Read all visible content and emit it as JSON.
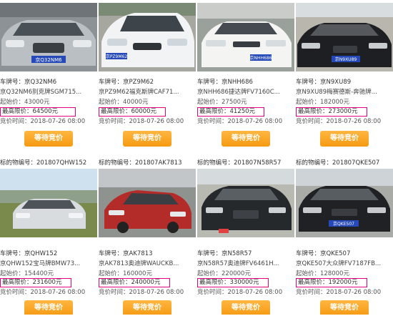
{
  "labels": {
    "lot_no": "标的物编号：",
    "plate": "车牌号：",
    "start_price": "起始价：",
    "max_price": "最高限价：",
    "bid_time": "竞价时间：",
    "bid_button": "等待竞价"
  },
  "cards": [
    {
      "lot_no": "",
      "plate": "京Q32NM6",
      "model": "京Q32NM6别克牌SGM715...",
      "start_price": "43000元",
      "max_price": "64500元",
      "bid_time": "2018-07-26 08:00"
    },
    {
      "lot_no": "",
      "plate": "京PZ9M62",
      "model": "京PZ9M62福克斯牌CAF71...",
      "start_price": "40000元",
      "max_price": "60000元",
      "bid_time": "2018-07-26 08:00"
    },
    {
      "lot_no": "",
      "plate": "京NHH686",
      "model": "京NHH686捷达牌FV7160C...",
      "start_price": "27500元",
      "max_price": "41250元",
      "bid_time": "2018-07-26 08:00"
    },
    {
      "lot_no": "",
      "plate": "京N9XU89",
      "model": "京N9XU89梅赛德斯-奔驰牌...",
      "start_price": "182000元",
      "max_price": "273000元",
      "bid_time": "2018-07-26 08:00"
    },
    {
      "lot_no": "201807QHW152",
      "plate": "京QHW152",
      "model": "京QHW152宝马牌BMW73...",
      "start_price": "154400元",
      "max_price": "231600元",
      "bid_time": "2018-07-26 08:00"
    },
    {
      "lot_no": "201807AK7813",
      "plate": "京AK7813",
      "model": "京AK7813奥迪牌WAUCKB...",
      "start_price": "160000元",
      "max_price": "240000元",
      "bid_time": "2018-07-26 08:00"
    },
    {
      "lot_no": "201807N58R57",
      "plate": "京N58R57",
      "model": "京N58R57奥迪牌FV6461H...",
      "start_price": "220000元",
      "max_price": "330000元",
      "bid_time": "2018-07-26 08:00"
    },
    {
      "lot_no": "201807QKE507",
      "plate": "京QKE507",
      "model": "京QKE507大众牌FV7187FB...",
      "start_price": "128000元",
      "max_price": "192000元",
      "bid_time": "2018-07-26 08:00"
    }
  ],
  "plate_texts": [
    "京Q32NM6",
    "京PZ9M62",
    "京NHH686",
    "京N9XU89",
    "京QHW152",
    "京AK7813",
    "京N58R57",
    "京QKE507"
  ],
  "colors": {
    "highlight_border": "#e4007f",
    "button_orange": "#f5a623"
  }
}
